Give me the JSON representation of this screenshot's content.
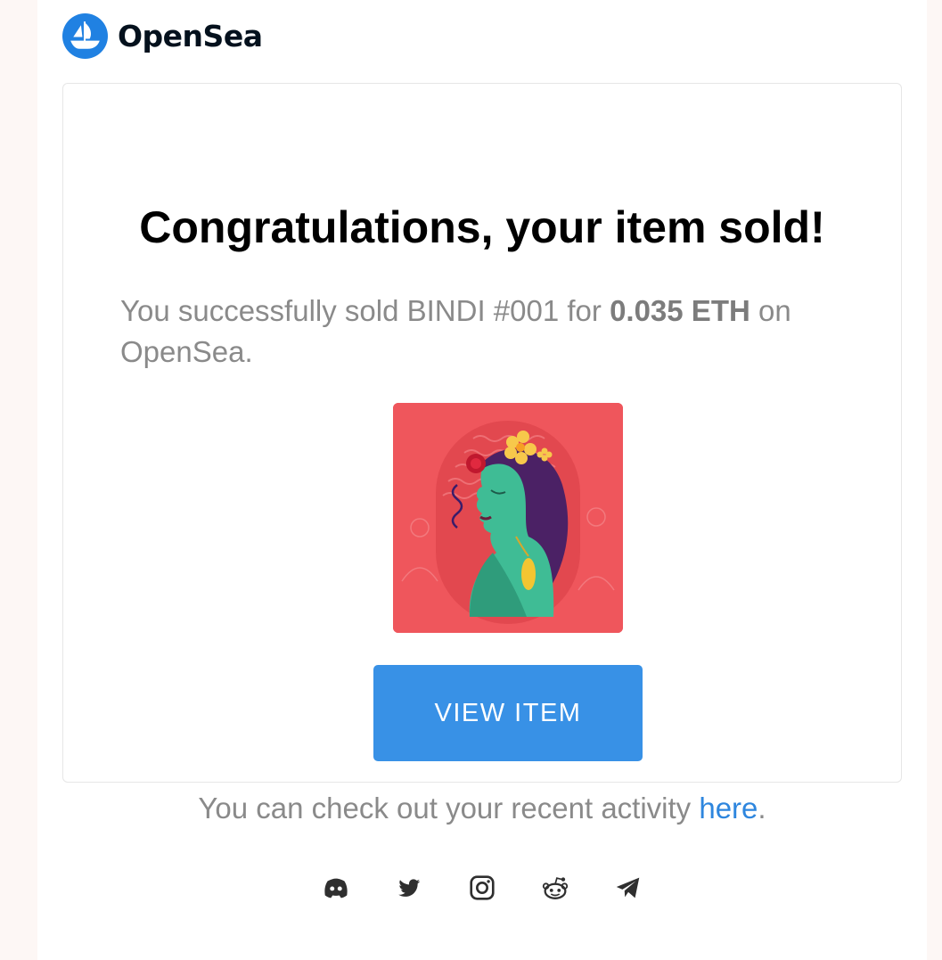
{
  "header": {
    "brand": "OpenSea"
  },
  "card": {
    "title": "Congratulations, your item sold!",
    "message_prefix": "You successfully sold BINDI #001 for ",
    "price": "0.035 ETH",
    "message_suffix": " on OpenSea.",
    "image_alt": "BINDI #001",
    "button_label": "VIEW ITEM",
    "activity_prefix": "You can check out your recent activity ",
    "activity_link": "here",
    "activity_suffix": "."
  },
  "colors": {
    "accent": "#3891e6",
    "link": "#2e86de",
    "logo_blue": "#2081e2",
    "nft_background": "#ef565c"
  },
  "footer": {
    "social_icons": [
      "discord-icon",
      "twitter-icon",
      "instagram-icon",
      "reddit-icon",
      "telegram-icon"
    ]
  }
}
